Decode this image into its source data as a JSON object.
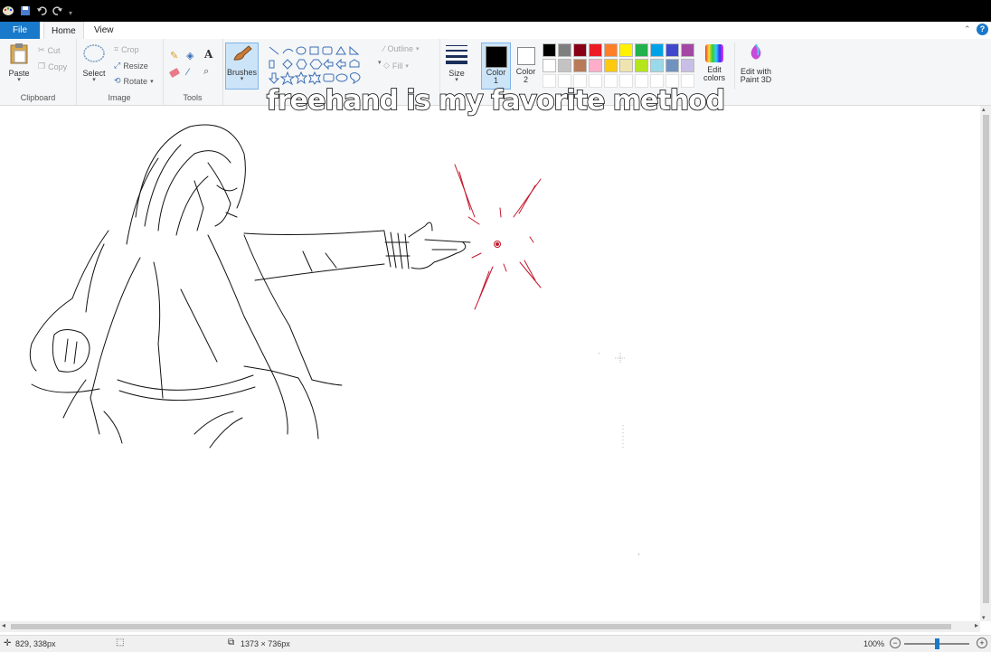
{
  "toolbar": {
    "file_label": "File",
    "home_label": "Home",
    "view_label": "View"
  },
  "clipboard": {
    "paste_label": "Paste",
    "cut_label": "Cut",
    "copy_label": "Copy",
    "group_label": "Clipboard"
  },
  "image": {
    "select_label": "Select",
    "crop_label": "Crop",
    "resize_label": "Resize",
    "rotate_label": "Rotate",
    "group_label": "Image"
  },
  "tools": {
    "group_label": "Tools",
    "brushes_label": "Brushes"
  },
  "shapes": {
    "outline_label": "Outline",
    "fill_label": "Fill"
  },
  "size": {
    "label": "Size"
  },
  "colors": {
    "color1_label": "Color",
    "color1_num": "1",
    "color2_label": "Color",
    "color2_num": "2",
    "edit_colors_label_line1": "Edit",
    "edit_colors_label_line2": "colors",
    "edit_paint3d_line1": "Edit with",
    "edit_paint3d_line2": "Paint 3D",
    "palette_row1": [
      "#000000",
      "#7f7f7f",
      "#880015",
      "#ed1c24",
      "#ff7f27",
      "#fff200",
      "#22b14c",
      "#00a2e8",
      "#3f48cc",
      "#a349a4"
    ],
    "palette_row2": [
      "#ffffff",
      "#c3c3c3",
      "#b97a57",
      "#ffaec9",
      "#ffc90e",
      "#efe4b0",
      "#b5e61d",
      "#99d9ea",
      "#7092be",
      "#c8bfe7"
    ]
  },
  "caption": "freehand is my favorite method",
  "status": {
    "cursor_pos": "829, 338px",
    "image_size": "1373 × 736px",
    "zoom": "100%"
  }
}
